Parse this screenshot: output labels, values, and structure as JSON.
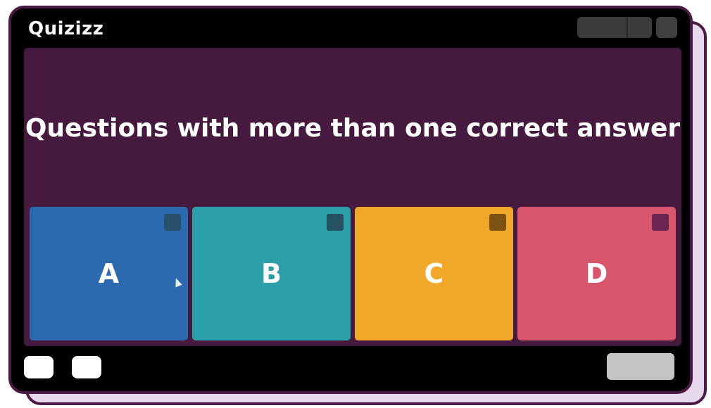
{
  "app": {
    "logo_text": "Quizizz"
  },
  "question": {
    "text": "Questions with more than one correct answer"
  },
  "options": [
    {
      "label": "A",
      "color": "#2b6aae",
      "checkbox_color": "#28506a"
    },
    {
      "label": "B",
      "color": "#2ca0a8",
      "checkbox_color": "#24535f"
    },
    {
      "label": "C",
      "color": "#efa82a",
      "checkbox_color": "#7c5213"
    },
    {
      "label": "D",
      "color": "#d8566b",
      "checkbox_color": "#6b2751"
    }
  ],
  "colors": {
    "frame_border": "#4a1a45",
    "question_bg": "#461a3f",
    "frame_bg": "#000000"
  }
}
